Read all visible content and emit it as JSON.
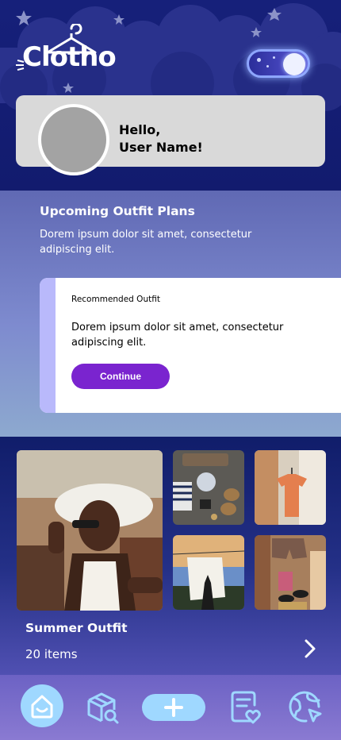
{
  "app": {
    "logo_text": "Clotho"
  },
  "profile": {
    "greeting_line1": "Hello,",
    "greeting_line2": "User Name!"
  },
  "plans": {
    "title": "Upcoming Outfit Plans",
    "description": "Dorem ipsum dolor sit amet, consectetur adipiscing elit.",
    "card": {
      "label": "Recommended Outfit",
      "text": "Dorem ipsum dolor sit amet, consectetur adipiscing elit.",
      "button_label": "Continue"
    }
  },
  "outfit": {
    "title": "Summer Outfit",
    "count": "20 items"
  },
  "nav": {
    "items": [
      "home-icon",
      "box-search-icon",
      "plus-icon",
      "list-heart-icon",
      "globe-icon"
    ]
  },
  "colors": {
    "header_bg": "#16207a",
    "accent_purple": "#7a24cf",
    "nav_highlight": "#9fd8ff",
    "card_accent": "#b9b9fb"
  }
}
